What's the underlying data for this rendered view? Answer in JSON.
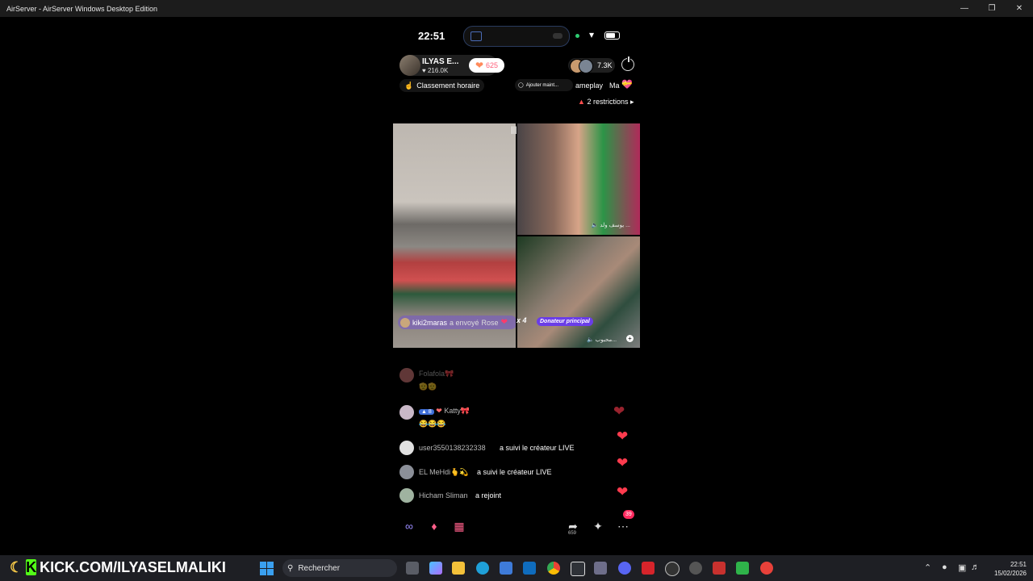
{
  "window": {
    "title": "AirServer - AirServer Windows Desktop Edition"
  },
  "phone": {
    "status": {
      "time": "22:51"
    },
    "host": {
      "name": "ILYAS E...",
      "likes": "216.0K",
      "heart_count": "625"
    },
    "viewers": {
      "count": "7.3K"
    },
    "pills": {
      "rank": "Classement horaire",
      "add": "Ajouter maint...",
      "gameplay": "ameplay",
      "ma": "Ma"
    },
    "restrictions": "2 restrictions",
    "video": {
      "gift": {
        "user": "kiki2maras",
        "action": "a envoyé",
        "item": "Rose",
        "count": "x 4"
      },
      "tile2_label": "يوسف ولد ...",
      "tile3_label": "محبوب...",
      "donor_badge": "Donateur principal"
    },
    "chat": [
      {
        "name": "Folafola🎀",
        "text": "🫡🫡"
      },
      {
        "level": "8",
        "name": "Katty🎀",
        "text": "😂😂😂"
      },
      {
        "name": "user3550138232338",
        "text": "a suivi le créateur LIVE"
      },
      {
        "name": "EL MeHdi🫰💫",
        "text": "a suivi le créateur LIVE"
      },
      {
        "name": "Hicham Sliman",
        "text": "a rejoint"
      }
    ],
    "bottom": {
      "share_count": "659",
      "more_badge": "39"
    }
  },
  "overlay": {
    "kick_url": "KICK.COM/ILYASELMALIKI"
  },
  "taskbar": {
    "search_placeholder": "Rechercher",
    "time": "22:51",
    "date": "15/02/2026"
  }
}
